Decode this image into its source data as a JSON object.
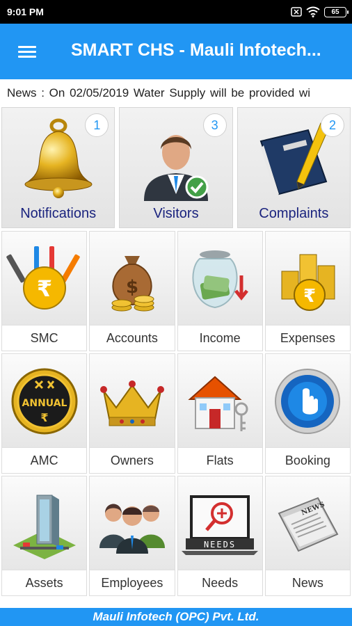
{
  "status_bar": {
    "time": "9:01 PM",
    "battery": "65",
    "icons": [
      "sim-off-icon",
      "wifi-icon",
      "battery-icon"
    ]
  },
  "app_bar": {
    "title": "SMART CHS - Mauli Infotech...",
    "menu_icon": "hamburger-menu-icon",
    "background_color": "#2196f3"
  },
  "news": {
    "text": "News :  On  02/05/2019 Water Supply will be provided wi"
  },
  "top_tiles": [
    {
      "label": "Notifications",
      "badge": "1",
      "icon": "bell-icon"
    },
    {
      "label": "Visitors",
      "badge": "3",
      "icon": "visitor-icon"
    },
    {
      "label": "Complaints",
      "badge": "2",
      "icon": "note-book-icon"
    }
  ],
  "grid_tiles": [
    {
      "label": "SMC",
      "icon": "tools-rupee-icon"
    },
    {
      "label": "Accounts",
      "icon": "money-bag-icon"
    },
    {
      "label": "Income",
      "icon": "money-jar-icon"
    },
    {
      "label": "Expenses",
      "icon": "coin-stacks-icon"
    },
    {
      "label": "AMC",
      "icon": "annual-badge-icon",
      "badge_text": "ANNUAL"
    },
    {
      "label": "Owners",
      "icon": "crown-icon"
    },
    {
      "label": "Flats",
      "icon": "house-keys-icon"
    },
    {
      "label": "Booking",
      "icon": "booking-touch-icon"
    },
    {
      "label": "Assets",
      "icon": "building-icon"
    },
    {
      "label": "Employees",
      "icon": "employees-icon"
    },
    {
      "label": "Needs",
      "icon": "needs-laptop-icon",
      "screen_text": "NEEDS"
    },
    {
      "label": "News",
      "icon": "newspaper-icon",
      "paper_text": "NEWS"
    }
  ],
  "footer": {
    "text": "Mauli Infotech (OPC) Pvt. Ltd."
  }
}
